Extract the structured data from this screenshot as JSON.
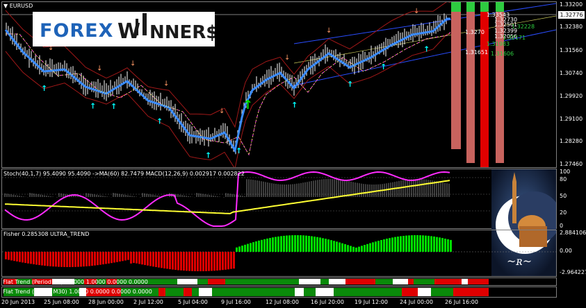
{
  "symbol": "EURUSD",
  "logo": {
    "text_a": "FOREX",
    "text_b": "W",
    "text_c": "NNER$"
  },
  "price_axis": {
    "ticks": [
      "1.33200",
      "1.32380",
      "1.31560",
      "1.30740",
      "1.29920",
      "1.29100",
      "1.28280",
      "1.27460"
    ],
    "current": "1.32776"
  },
  "price_labels": {
    "white": [
      "1.33543",
      "1.32730",
      "1.32501",
      "1.32399",
      "1.32056",
      "1.31651"
    ],
    "green": [
      "1.32228",
      "1.32171",
      "1.31983",
      "1.31606"
    ],
    "extra_white": "1.3270"
  },
  "stoch_panel": {
    "header": "Stoch(40,1,7) 95.4090 95.4090  ->MA(60) 82.7479  MACD(12,26,9) 0.002917 0.002822",
    "ticks": [
      "100",
      "80",
      "50",
      "20",
      "0"
    ]
  },
  "fisher_panel": {
    "header": "Fisher 0.285308  ULTRA_TREND",
    "ticks": [
      "2.884106",
      "0.00",
      "-2.964227"
    ]
  },
  "flat1": {
    "header": "Flat Trend (Period  H1) 0.0000 1.0000 0.0000 0.0000"
  },
  "flat2": {
    "header": "Flat Trend (Period M30) 1.0000 0.0000 0.0000 0.0000"
  },
  "time_axis": [
    "20 Jun 2013",
    "25 Jun 08:00",
    "28 Jun 00:00",
    "2 Jul 12:00",
    "5 Jul 04:00",
    "9 Jul 16:00",
    "12 Jul 08:00",
    "16 Jul 20:00",
    "19 Jul 12:00",
    "24 Jul 00:00",
    "26 Jul 16:00"
  ],
  "colors": {
    "candle": "#ffffff",
    "ma_blue": "#3a8bff",
    "bands": "#a01818",
    "magenta": "#ff2bff",
    "yellow": "#ffff33",
    "bull": "#00e000",
    "bear": "#e00000",
    "up_arrow": "#00ffff",
    "down_arrow": "#ff9966"
  }
}
